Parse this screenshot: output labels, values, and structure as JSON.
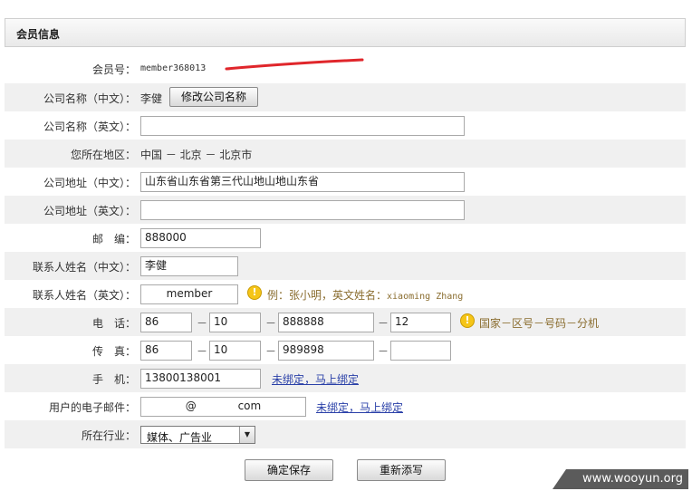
{
  "section": {
    "title": "会员信息"
  },
  "member_id": {
    "label": "会员号：",
    "value": "member368013"
  },
  "company_cn": {
    "label": "公司名称（中文）：",
    "value": "李健",
    "button": "修改公司名称"
  },
  "company_en": {
    "label": "公司名称（英文）：",
    "value": ""
  },
  "region": {
    "label": "您所在地区：",
    "value": "中国 － 北京 － 北京市"
  },
  "address_cn": {
    "label": "公司地址（中文）：",
    "value": "山东省山东省第三代山地山地山东省"
  },
  "address_en": {
    "label": "公司地址（英文）：",
    "value": ""
  },
  "postcode": {
    "label": "邮　编：",
    "value": "888000"
  },
  "contact_cn": {
    "label": "联系人姓名（中文）：",
    "value": "李健"
  },
  "contact_en": {
    "label": "联系人姓名（英文）：",
    "value": "member",
    "hint_prefix": "例：张小明，英文姓名：",
    "hint_example": "xiaoming Zhang"
  },
  "phone": {
    "label": "电　话：",
    "country": "86",
    "area": "10",
    "number": "888888",
    "ext": "12",
    "separator": "－",
    "hint": "国家－区号－号码－分机"
  },
  "fax": {
    "label": "传　真：",
    "country": "86",
    "area": "10",
    "number": "989898",
    "ext": "",
    "separator": "－"
  },
  "mobile": {
    "label": "手　机：",
    "value": "13800138001",
    "link": "未绑定，马上绑定"
  },
  "email": {
    "label": "用户的电子邮件：",
    "value": "@            com",
    "link": "未绑定，马上绑定"
  },
  "industry": {
    "label": "所在行业：",
    "selected": "媒体、广告业"
  },
  "buttons": {
    "save": "确定保存",
    "reset": "重新添写"
  },
  "watermark": "www.wooyun.org",
  "colors": {
    "row_alt": "#f0f0f0",
    "link": "#2a40a8",
    "hint": "#8a6d2f",
    "annotation": "#e0262b"
  },
  "icons": {
    "warning": "warning-icon",
    "dropdown": "chevron-down-icon"
  }
}
